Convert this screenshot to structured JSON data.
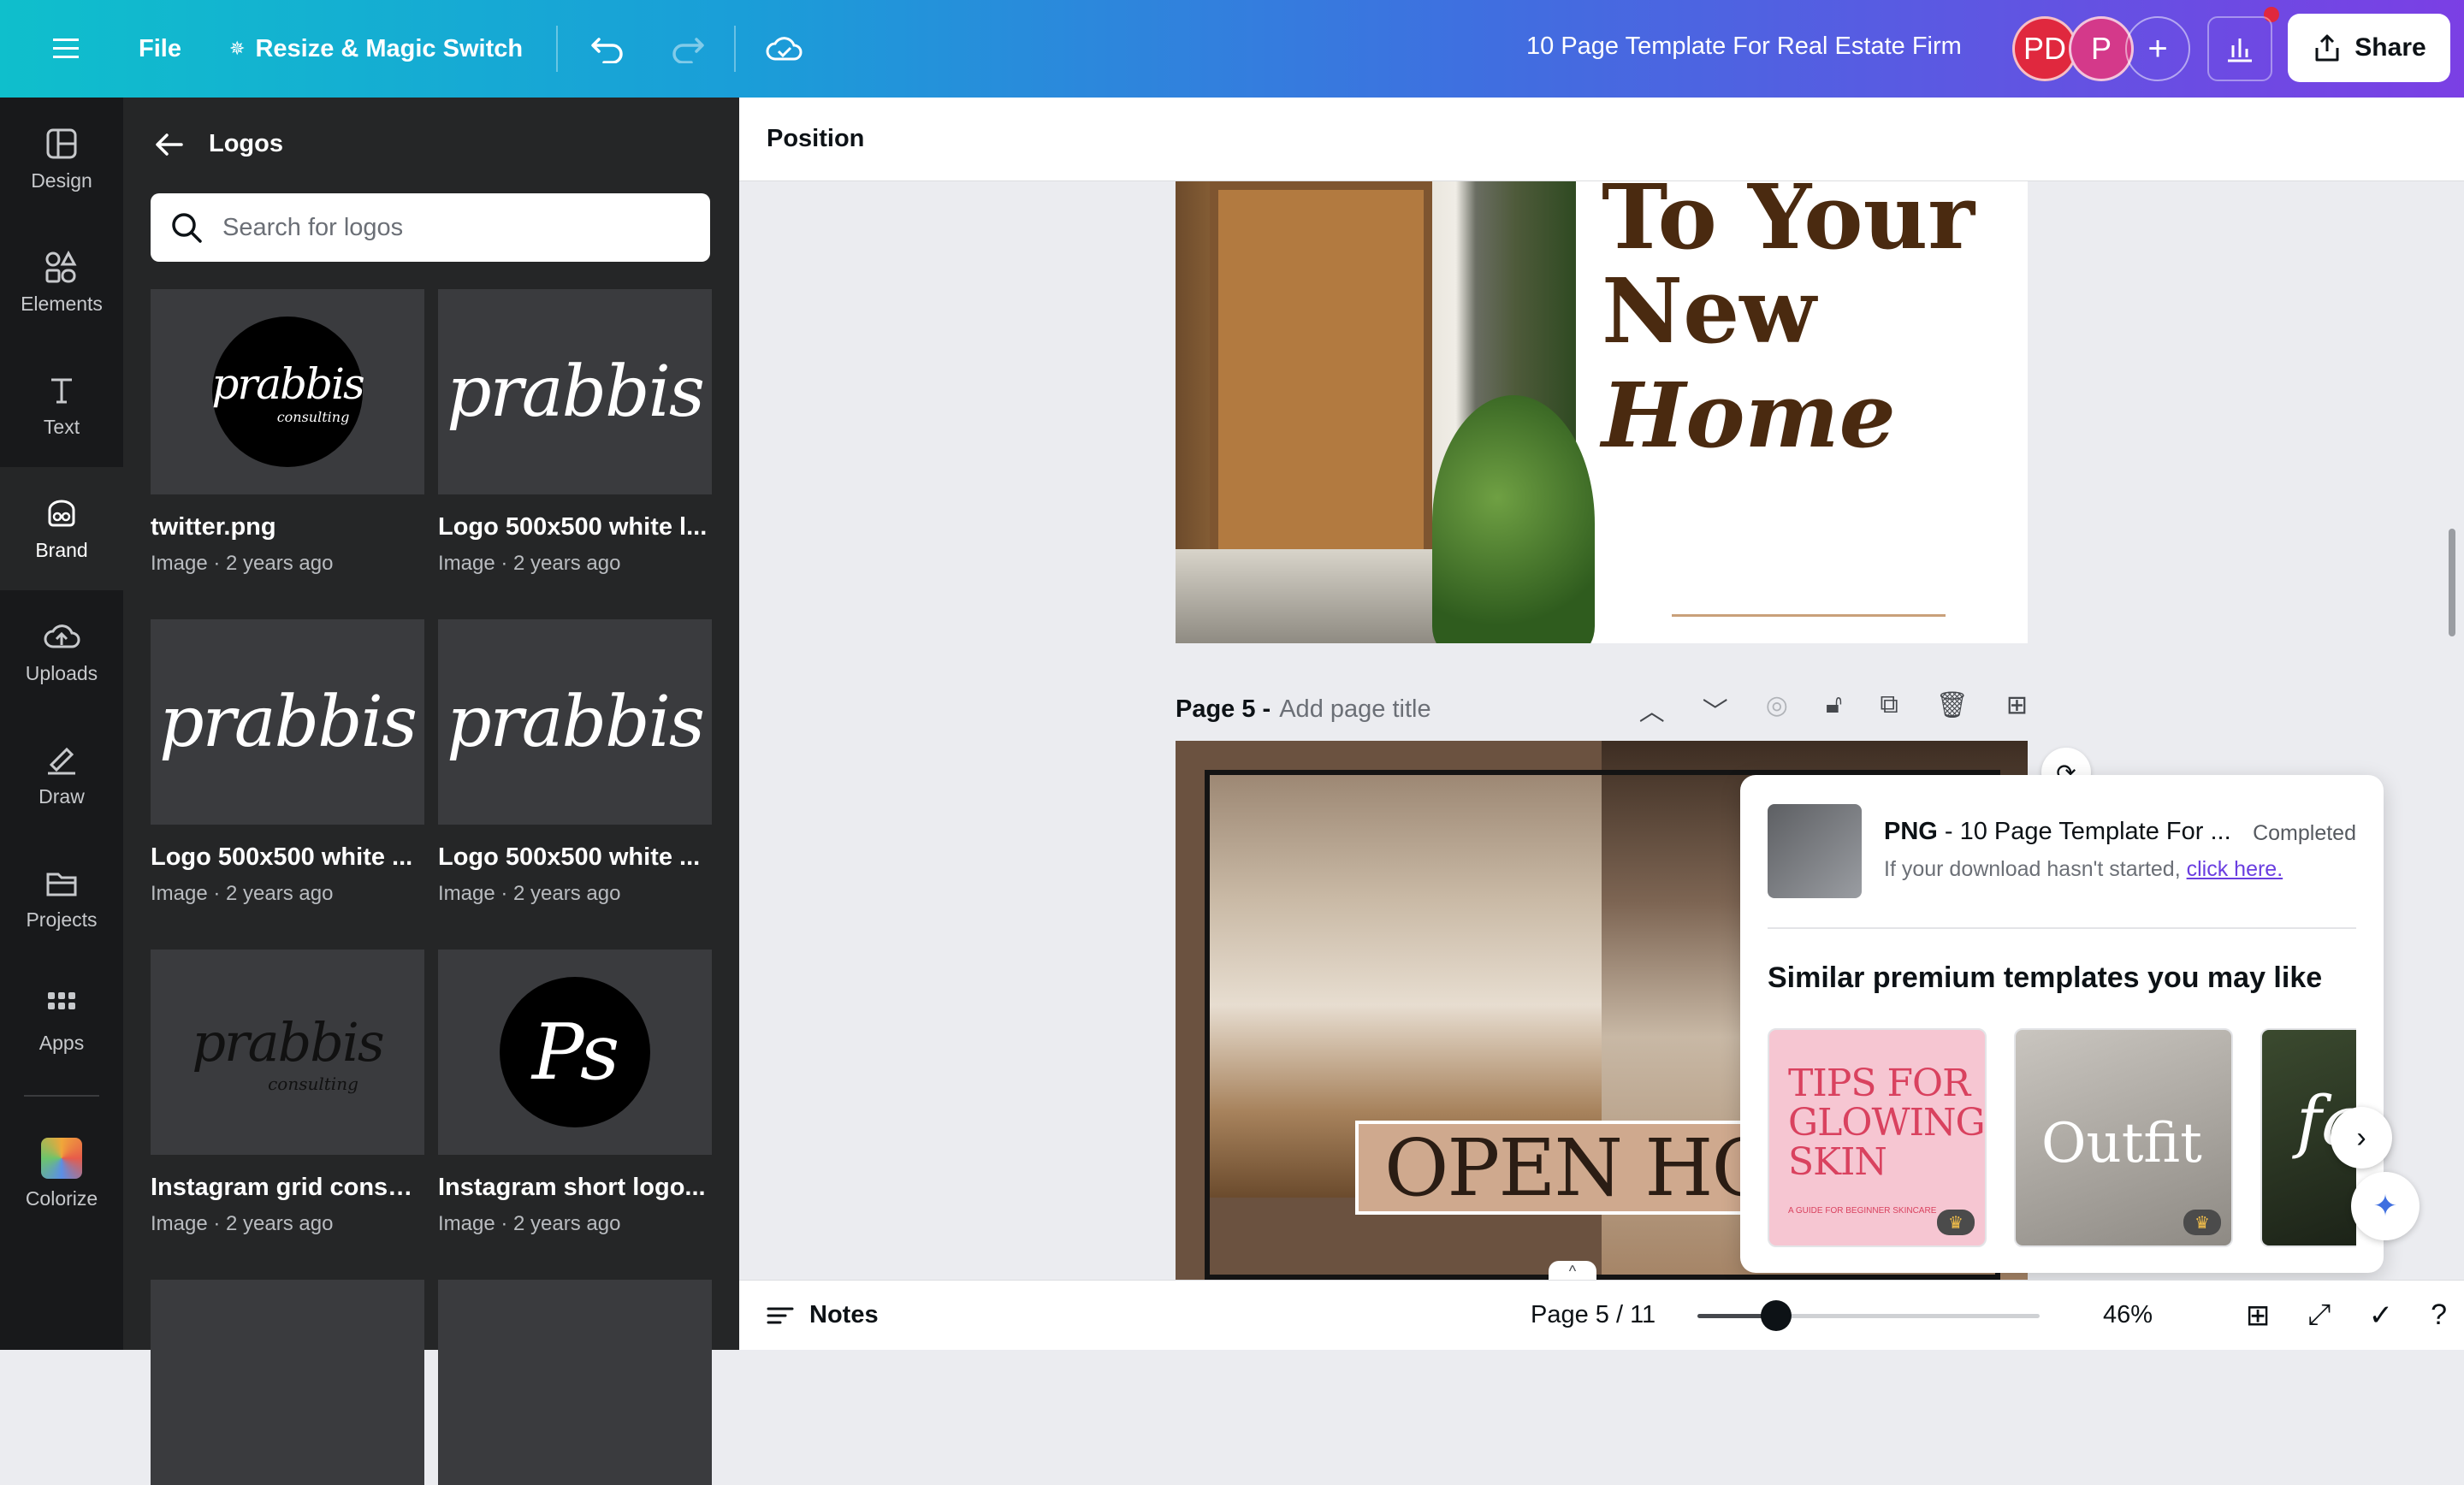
{
  "topbar": {
    "file_label": "File",
    "resize_label": "Resize & Magic Switch",
    "doc_title": "10 Page Template For Real Estate Firm",
    "avatars": [
      {
        "initials": "PD",
        "color": "#e0283e"
      },
      {
        "initials": "P",
        "color": "#d4398a"
      }
    ],
    "share_label": "Share"
  },
  "rail": {
    "items": [
      {
        "label": "Design",
        "icon": "design-icon"
      },
      {
        "label": "Elements",
        "icon": "elements-icon"
      },
      {
        "label": "Text",
        "icon": "text-icon"
      },
      {
        "label": "Brand",
        "icon": "brand-icon"
      },
      {
        "label": "Uploads",
        "icon": "uploads-icon"
      },
      {
        "label": "Draw",
        "icon": "draw-icon"
      },
      {
        "label": "Projects",
        "icon": "projects-icon"
      },
      {
        "label": "Apps",
        "icon": "apps-icon"
      },
      {
        "label": "Colorize",
        "icon": "colorize-icon"
      }
    ]
  },
  "panel": {
    "title": "Logos",
    "search_placeholder": "Search for logos",
    "logo_text": "prabbis",
    "logo_sub": "consulting",
    "logo_ps": "Ps",
    "items": [
      {
        "title": "twitter.png",
        "meta": "Image · 2 years ago"
      },
      {
        "title": "Logo 500x500 white l...",
        "meta": "Image · 2 years ago"
      },
      {
        "title": "Logo 500x500 white ...",
        "meta": "Image · 2 years ago"
      },
      {
        "title": "Logo 500x500 white ...",
        "meta": "Image · 2 years ago"
      },
      {
        "title": "Instagram grid consul...",
        "meta": "Image · 2 years ago"
      },
      {
        "title": "Instagram short logo...",
        "meta": "Image · 2 years ago"
      }
    ]
  },
  "toolbar": {
    "position_label": "Position"
  },
  "canvas": {
    "page4_lines": [
      "To Your",
      "New",
      "Home"
    ],
    "page5_label": "Page 5 -",
    "page5_placeholder": "Add page title",
    "open_house": "OPEN HOU"
  },
  "popup": {
    "file_type": "PNG",
    "file_name": " - 10 Page Template For ...",
    "status": "Completed",
    "hint": "If your download hasn't started,",
    "link": "click here.",
    "similar_heading": "Similar premium templates you may like",
    "templates": [
      {
        "text": "TIPS FOR GLOWING SKIN",
        "sub": "A GUIDE FOR BEGINNER SKINCARE"
      },
      {
        "text": "Outfit"
      },
      {
        "text": "fa"
      }
    ]
  },
  "bottombar": {
    "notes_label": "Notes",
    "page_indicator": "Page 5 / 11",
    "zoom": "46%",
    "zoom_fraction": 0.46
  }
}
